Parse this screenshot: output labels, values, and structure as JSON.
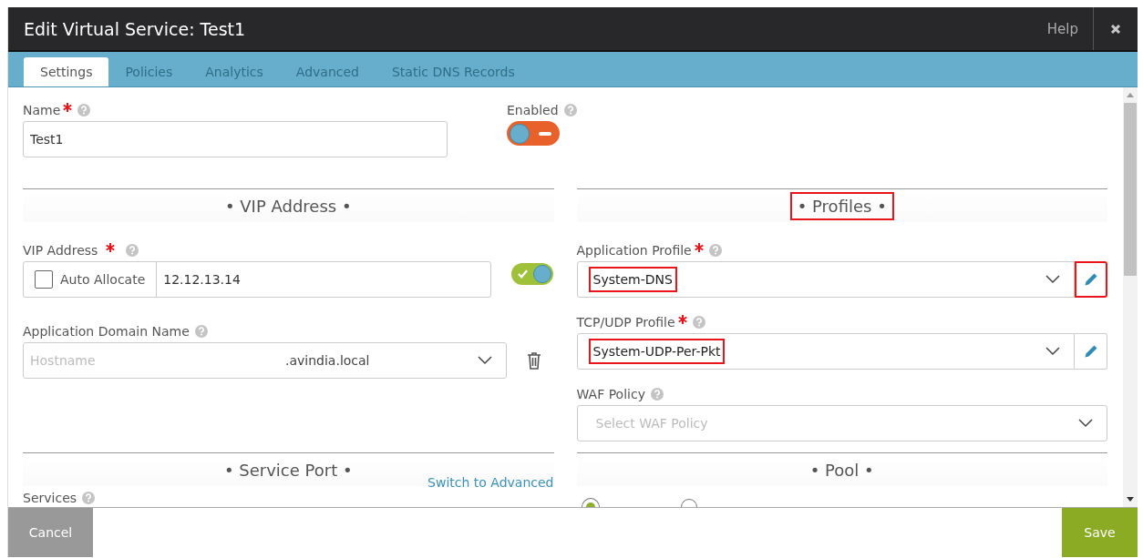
{
  "window": {
    "title": "Edit Virtual Service: Test1",
    "help": "Help"
  },
  "tabs": [
    {
      "label": "Settings",
      "selected": true
    },
    {
      "label": "Policies",
      "selected": false
    },
    {
      "label": "Analytics",
      "selected": false
    },
    {
      "label": "Advanced",
      "selected": false
    },
    {
      "label": "Static DNS Records",
      "selected": false
    }
  ],
  "name_field": {
    "label": "Name",
    "required": true,
    "value": "Test1"
  },
  "enabled": {
    "label": "Enabled",
    "on": false
  },
  "vip_section": {
    "title": "• VIP Address •",
    "highlighted": false
  },
  "vip_field": {
    "label": "VIP Address",
    "required": true,
    "auto_allocate": {
      "label": "Auto Allocate",
      "checked": false
    },
    "value": "12.12.13.14",
    "on": true
  },
  "domain_field": {
    "label": "Application Domain Name",
    "placeholder": "Hostname",
    "suffix": ".avindia.local"
  },
  "profiles_section": {
    "title": "• Profiles •",
    "highlighted": true
  },
  "profile_fields": [
    {
      "label": "Application Profile",
      "required": true,
      "value": "System-DNS",
      "highlighted": true,
      "editable": true,
      "edit_highlighted": true
    },
    {
      "label": "TCP/UDP Profile",
      "required": true,
      "value": "System-UDP-Per-Pkt",
      "highlighted": true,
      "editable": true,
      "edit_highlighted": false
    },
    {
      "label": "WAF Policy",
      "required": false,
      "placeholder": "Select WAF Policy"
    }
  ],
  "service_port_section": {
    "title": "• Service Port •",
    "highlighted": false,
    "link": "Switch to Advanced",
    "services_label": "Services"
  },
  "pool_section": {
    "title": "• Pool •",
    "highlighted": false,
    "options": [
      {
        "selected": true
      },
      {
        "selected": false
      }
    ]
  },
  "footer": {
    "cancel": "Cancel",
    "save": "Save"
  }
}
